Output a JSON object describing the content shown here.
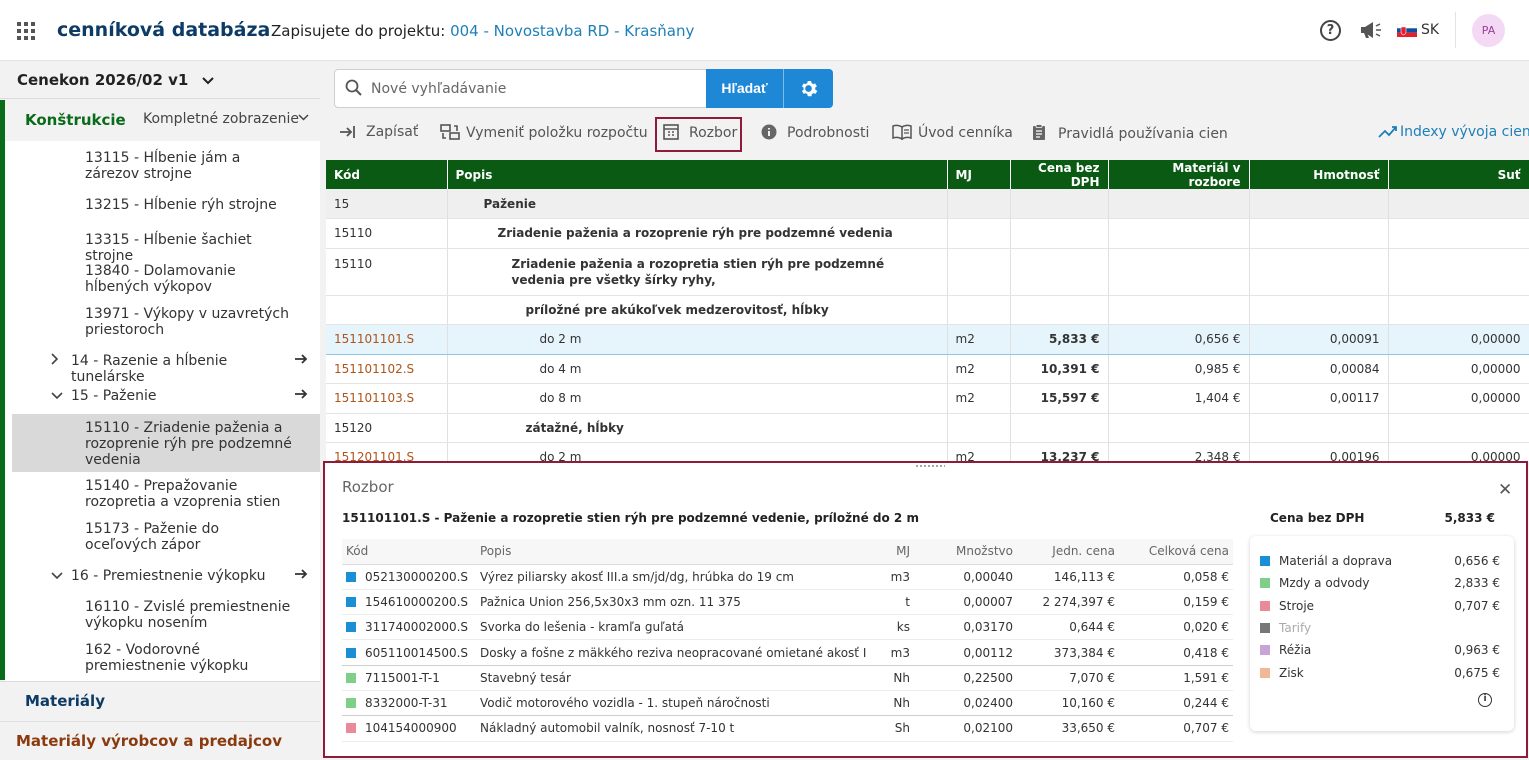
{
  "header": {
    "app_title": "cenníková databáza",
    "project_prefix": "Zapisujete do projektu:",
    "project_name": "004 - Novostavba RD - Krasňany",
    "language": "SK",
    "user_initials": "PA"
  },
  "sidebar": {
    "catalog": "Cenekon 2026/02 v1",
    "active_tab": "Konštrukcie",
    "view_mode": "Kompletné zobrazenie",
    "items": [
      {
        "label": "13115 - Hĺbenie jám a zárezov strojne"
      },
      {
        "label": "13215 - Hĺbenie rýh strojne"
      },
      {
        "label": "13315 - Hĺbenie šachiet strojne"
      },
      {
        "label": "13840 - Dolamovanie hĺbených výkopov"
      },
      {
        "label": "13971 - Výkopy v uzavretých priestoroch"
      },
      {
        "label": "14 - Razenie a hĺbenie tunelárske"
      },
      {
        "label": "15 - Paženie"
      },
      {
        "label": "15110 - Zriadenie paženia a rozoprenie rýh pre podzemné vedenia"
      },
      {
        "label": "15140 - Prepažovanie rozopretia a vzoprenia stien"
      },
      {
        "label": "15173 - Paženie do oceľových zápor"
      },
      {
        "label": "16 - Premiestnenie výkopku"
      },
      {
        "label": "16110 - Zvislé premiestnenie výkopku nosením"
      },
      {
        "label": "162 - Vodorovné premiestnenie výkopku"
      }
    ],
    "materials": "Materiály",
    "vendor_materials": "Materiály výrobcov a predajcov"
  },
  "search": {
    "placeholder": "Nové vyhľadávanie",
    "button": "Hľadať"
  },
  "toolbar": {
    "zapisat": "Zapísať",
    "vymenit": "Vymeniť položku rozpočtu",
    "rozbor": "Rozbor",
    "podrobnosti": "Podrobnosti",
    "uvod": "Úvod cenníka",
    "pravidla": "Pravidlá používania cien",
    "indexy": "Indexy vývoja cien"
  },
  "table": {
    "headers": [
      "Kód",
      "Popis",
      "MJ",
      "Cena bez DPH",
      "Materiál v rozbore",
      "Hmotnosť",
      "Suť"
    ],
    "rows": [
      {
        "code": "15",
        "desc": "Paženie",
        "mj": "",
        "price": "",
        "mat": "",
        "mass": "",
        "sut": ""
      },
      {
        "code": "15110",
        "desc": "Zriadenie paženia a rozoprenie rýh pre podzemné vedenia",
        "mj": "",
        "price": "",
        "mat": "",
        "mass": "",
        "sut": ""
      },
      {
        "code": "15110",
        "desc": "Zriadenie paženia a rozopretia stien rýh pre podzemné vedenia pre všetky šírky ryhy,",
        "mj": "",
        "price": "",
        "mat": "",
        "mass": "",
        "sut": ""
      },
      {
        "code": "",
        "desc": "príložné pre akúkoľvek medzerovitosť, hĺbky",
        "mj": "",
        "price": "",
        "mat": "",
        "mass": "",
        "sut": ""
      },
      {
        "code": "151101101.S",
        "desc": "do 2 m",
        "mj": "m2",
        "price": "5,833 €",
        "mat": "0,656 €",
        "mass": "0,00091",
        "sut": "0,00000"
      },
      {
        "code": "151101102.S",
        "desc": "do 4 m",
        "mj": "m2",
        "price": "10,391 €",
        "mat": "0,985 €",
        "mass": "0,00084",
        "sut": "0,00000"
      },
      {
        "code": "151101103.S",
        "desc": "do 8 m",
        "mj": "m2",
        "price": "15,597 €",
        "mat": "1,404 €",
        "mass": "0,00117",
        "sut": "0,00000"
      },
      {
        "code": "15120",
        "desc": "zátažné, hĺbky",
        "mj": "",
        "price": "",
        "mat": "",
        "mass": "",
        "sut": ""
      },
      {
        "code": "151201101.S",
        "desc": "do 2 m",
        "mj": "m2",
        "price": "13,237 €",
        "mat": "2,348 €",
        "mass": "0,00196",
        "sut": "0,00000"
      }
    ]
  },
  "rozbor": {
    "title": "Rozbor",
    "item": "151101101.S - Paženie a rozopretie stien rýh pre podzemné vedenie, príložné do 2 m",
    "price_label": "Cena bez DPH",
    "price_value": "5,833 €",
    "headers": [
      "Kód",
      "Popis",
      "MJ",
      "Množstvo",
      "Jedn. cena",
      "Celková cena"
    ],
    "rows": [
      {
        "color": "#1a8fd6",
        "code": "052130000200.S",
        "desc": "Výrez piliarsky akosť III.a sm/jd/dg, hrúbka do 19 cm",
        "mj": "m3",
        "qty": "0,00040",
        "unit": "146,113 €",
        "total": "0,058 €"
      },
      {
        "color": "#1a8fd6",
        "code": "154610000200.S",
        "desc": "Pažnica Union 256,5x30x3 mm ozn. 11 375",
        "mj": "t",
        "qty": "0,00007",
        "unit": "2 274,397 €",
        "total": "0,159 €"
      },
      {
        "color": "#1a8fd6",
        "code": "311740002000.S",
        "desc": "Svorka do lešenia - kramľa guľatá",
        "mj": "ks",
        "qty": "0,03170",
        "unit": "0,644 €",
        "total": "0,020 €"
      },
      {
        "color": "#1a8fd6",
        "code": "605110014500.S",
        "desc": "Dosky a fošne z mäkkého reziva neopracované omietané akosť I",
        "mj": "m3",
        "qty": "0,00112",
        "unit": "373,384 €",
        "total": "0,418 €"
      },
      {
        "color": "#7fcf8a",
        "code": "7115001-T-1",
        "desc": "Stavebný tesár",
        "mj": "Nh",
        "qty": "0,22500",
        "unit": "7,070 €",
        "total": "1,591 €"
      },
      {
        "color": "#7fcf8a",
        "code": "8332000-T-31",
        "desc": "Vodič motorového vozidla - 1. stupeň náročnosti",
        "mj": "Nh",
        "qty": "0,02400",
        "unit": "10,160 €",
        "total": "0,244 €"
      },
      {
        "color": "#e88a9a",
        "code": "104154000900",
        "desc": "Nákladný automobil valník, nosnosť 7-10 t",
        "mj": "Sh",
        "qty": "0,02100",
        "unit": "33,650 €",
        "total": "0,707 €"
      }
    ],
    "legend": [
      {
        "label": "Materiál a doprava",
        "value": "0,656 €",
        "color": "#1a8fd6"
      },
      {
        "label": "Mzdy a odvody",
        "value": "2,833 €",
        "color": "#7fcf8a"
      },
      {
        "label": "Stroje",
        "value": "0,707 €",
        "color": "#e88a9a"
      },
      {
        "label": "Tarify",
        "value": "",
        "color": "#777777"
      },
      {
        "label": "Réžia",
        "value": "0,963 €",
        "color": "#c9a3d6"
      },
      {
        "label": "Zisk",
        "value": "0,675 €",
        "color": "#f0b896"
      }
    ]
  }
}
